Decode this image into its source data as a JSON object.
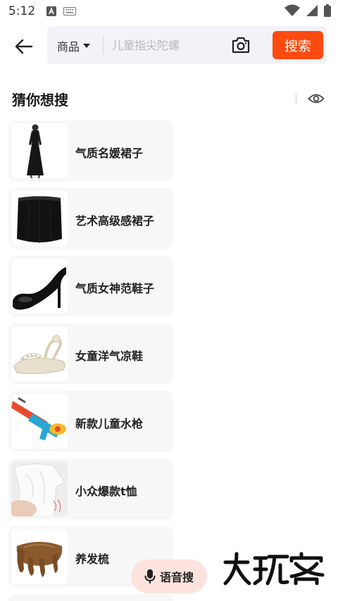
{
  "status_bar": {
    "time": "5:12"
  },
  "header": {
    "scope_label": "商品",
    "search_placeholder": "儿童指尖陀螺",
    "search_button_label": "搜索"
  },
  "section": {
    "title": "猜你想搜"
  },
  "suggestions": [
    {
      "label": "气质名媛裙子",
      "image": "black-dress"
    },
    {
      "label": "艺术高级感裙子",
      "image": "black-skirt"
    },
    {
      "label": "气质女神范鞋子",
      "image": "black-heel"
    },
    {
      "label": "女童洋气凉鞋",
      "image": "beige-sandal"
    },
    {
      "label": "新款儿童水枪",
      "image": "water-gun"
    },
    {
      "label": "小众爆款t恤",
      "image": "white-tshirt"
    },
    {
      "label": "养发梳",
      "image": "wooden-comb"
    }
  ],
  "voice_search": {
    "label": "语音搜"
  },
  "watermark": {
    "text": "大玩客"
  },
  "colors": {
    "accent": "#ff4a0f",
    "search_bg": "#f1f3f7",
    "card_bg": "#f7f7f7",
    "voice_bg": "#fde3dd"
  }
}
